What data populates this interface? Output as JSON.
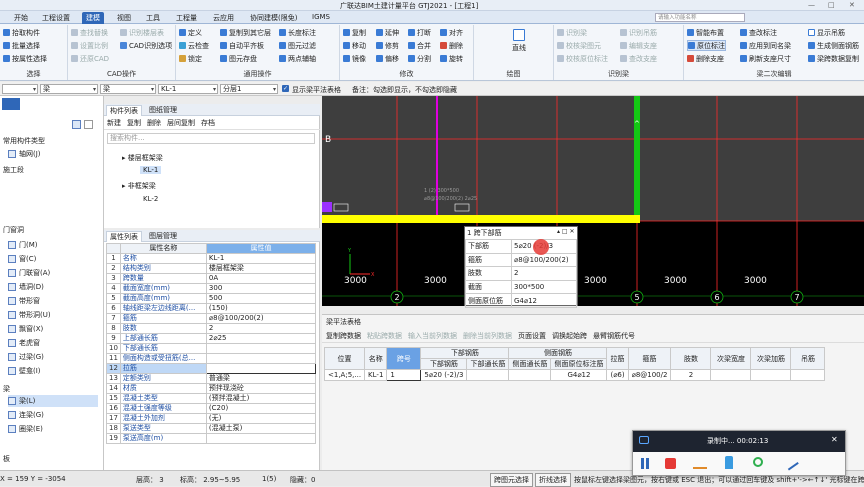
{
  "app": {
    "title": "广联达BIM土建计量平台 GTJ2021 - [工程1]",
    "window_controls": [
      "—",
      "□",
      "✕"
    ]
  },
  "ribbon_tabs": [
    "开始",
    "工程设置",
    "建模",
    "视图",
    "工具",
    "工程量",
    "云应用",
    "协同建模(限免)",
    "IGMS"
  ],
  "ribbon_active_tab": "建模",
  "search_placeholder": "请输入功能名称",
  "ribbon": {
    "select_group": {
      "label": "选择",
      "items": [
        "拾取构件",
        "批量选择",
        "按属性选择"
      ]
    },
    "cad_group": {
      "label": "CAD操作",
      "items": [
        "查找替换",
        "设置比例",
        "还原CAD",
        "识别楼层表",
        "CAD识别选项"
      ]
    },
    "common_group": {
      "label": "通用操作",
      "items": [
        "定义",
        "云检查",
        "锁定",
        "复制到其它层",
        "自动平齐板",
        "图元存盘",
        "长度标注",
        "图元过滤",
        "两点辅轴"
      ]
    },
    "modify_group": {
      "label": "修改",
      "items": [
        "复制",
        "移动",
        "镜像",
        "延伸",
        "修剪",
        "偏移",
        "打断",
        "合并",
        "分割",
        "对齐",
        "删除",
        "旋转"
      ]
    },
    "draw_group": {
      "label": "绘图",
      "items": [
        "直线"
      ]
    },
    "identify_group": {
      "label": "识别梁",
      "items": [
        "识别梁",
        "校核梁图元",
        "校核原位标注",
        "识别吊筋",
        "编辑支座",
        "查改支座"
      ]
    },
    "beam_group": {
      "label": "梁二次编辑",
      "items": [
        "智能布置",
        "原位标注",
        "删除支座",
        "查改标注",
        "应用到同名梁",
        "刷新支座尺寸",
        "显示吊筋",
        "生成侧面钢筋",
        "梁跨数据复制"
      ]
    }
  },
  "property_bar": {
    "floor_select": "",
    "category_select": "梁",
    "type_select": "梁",
    "name_select": "KL-1",
    "layer_select": "分层1",
    "show_beam_table_label": "显示梁平法表格",
    "hint": "备注：勾选即显示，不勾选即隐藏"
  },
  "left_nav": {
    "header": "常用构件类型",
    "items": [
      {
        "label": "轴网(J)",
        "icon": "grid-icon"
      },
      {
        "label": "施工段",
        "icon": "section-icon"
      },
      {
        "label": "门窗洞",
        "icon": "folder-icon"
      },
      {
        "label": "门(M)",
        "icon": "door-icon"
      },
      {
        "label": "窗(C)",
        "icon": "window-icon"
      },
      {
        "label": "门联窗(A)",
        "icon": "door-window-icon"
      },
      {
        "label": "墙洞(D)",
        "icon": "wall-hole-icon"
      },
      {
        "label": "带形窗",
        "icon": "strip-window-icon"
      },
      {
        "label": "带形洞(U)",
        "icon": "strip-hole-icon"
      },
      {
        "label": "飘窗(X)",
        "icon": "bay-window-icon"
      },
      {
        "label": "老虎窗",
        "icon": "dormer-icon"
      },
      {
        "label": "过梁(G)",
        "icon": "lintel-icon"
      },
      {
        "label": "壁龛(I)",
        "icon": "niche-icon"
      },
      {
        "label": "梁",
        "icon": "folder-icon"
      },
      {
        "label": "梁(L)",
        "icon": "beam-icon"
      },
      {
        "label": "连梁(G)",
        "icon": "coupling-beam-icon"
      },
      {
        "label": "圈梁(E)",
        "icon": "ring-beam-icon"
      },
      {
        "label": "板",
        "icon": "folder-icon"
      }
    ]
  },
  "component_panel": {
    "tabs": [
      "构件列表",
      "图纸管理"
    ],
    "toolbar": [
      "新建",
      "复制",
      "删除",
      "层间复制",
      "存档"
    ],
    "search_placeholder": "搜索构件...",
    "tree": [
      {
        "label": "楼层框架梁",
        "children": [
          "KL-1"
        ]
      },
      {
        "label": "非框架梁",
        "children": [
          "KL-2"
        ]
      }
    ]
  },
  "properties_panel": {
    "tabs": [
      "属性列表",
      "图层管理"
    ],
    "headers": [
      "属性名称",
      "属性值"
    ],
    "rows": [
      {
        "no": "1",
        "name": "名称",
        "value": "KL-1"
      },
      {
        "no": "2",
        "name": "结构类别",
        "value": "楼层框架梁"
      },
      {
        "no": "3",
        "name": "跨数量",
        "value": "0A"
      },
      {
        "no": "4",
        "name": "截面宽度(mm)",
        "value": "300"
      },
      {
        "no": "5",
        "name": "截面高度(mm)",
        "value": "500"
      },
      {
        "no": "6",
        "name": "轴线距梁左边线距离(...",
        "value": "(150)"
      },
      {
        "no": "7",
        "name": "箍筋",
        "value": "⌀8@100/200(2)"
      },
      {
        "no": "8",
        "name": "肢数",
        "value": "2"
      },
      {
        "no": "9",
        "name": "上部通长筋",
        "value": "2⌀25"
      },
      {
        "no": "10",
        "name": "下部通长筋",
        "value": ""
      },
      {
        "no": "11",
        "name": "侧面构造或受扭筋(总...",
        "value": ""
      },
      {
        "no": "12",
        "name": "拉筋",
        "value": ""
      },
      {
        "no": "13",
        "name": "定额类别",
        "value": "普通梁"
      },
      {
        "no": "14",
        "name": "材质",
        "value": "预拌现浇砼"
      },
      {
        "no": "15",
        "name": "混凝土类型",
        "value": "(预拌混凝土)"
      },
      {
        "no": "16",
        "name": "混凝土强度等级",
        "value": "(C20)"
      },
      {
        "no": "17",
        "name": "混凝土外加剂",
        "value": "(无)"
      },
      {
        "no": "18",
        "name": "泵送类型",
        "value": "(混凝土泵)"
      },
      {
        "no": "19",
        "name": "泵送高度(m)",
        "value": ""
      }
    ]
  },
  "canvas": {
    "axis_label": "B",
    "grid_labels": [
      "2",
      "3",
      "4",
      "5",
      "6",
      "7"
    ],
    "dims": [
      "3000",
      "3000",
      "3000",
      "3000",
      "3000",
      "3000"
    ],
    "note": "1 (2) 300*500",
    "note2": "⌀8@100/200(2) 2⌀25",
    "axes": {
      "x": "X",
      "y": "Y"
    }
  },
  "popup": {
    "title": "1 跨下部筋",
    "rows": [
      {
        "k": "下部筋",
        "v": "5⌀20 (-2)/3"
      },
      {
        "k": "箍筋",
        "v": "⌀8@100/200(2)"
      },
      {
        "k": "肢数",
        "v": "2"
      },
      {
        "k": "截面",
        "v": "300*500"
      },
      {
        "k": "侧面原位筋",
        "v": "G4⌀12"
      }
    ]
  },
  "beam_table": {
    "title": "梁平法表格",
    "toolbar": [
      {
        "label": "复制跨数据",
        "enabled": true
      },
      {
        "label": "粘贴跨数据",
        "enabled": false
      },
      {
        "label": "输入当前列数据",
        "enabled": false
      },
      {
        "label": "删除当前列数据",
        "enabled": false
      },
      {
        "label": "页面设置",
        "enabled": true
      },
      {
        "label": "调换起始跨",
        "enabled": true
      },
      {
        "label": "悬臂钢筋代号",
        "enabled": true
      }
    ],
    "group_headers": [
      "下部钢筋",
      "侧面钢筋"
    ],
    "headers": [
      "位置",
      "名称",
      "跨号",
      "下部钢筋",
      "下部通长筋",
      "侧面通长筋",
      "侧面原位标注筋",
      "拉筋",
      "箍筋",
      "肢数",
      "次梁宽度",
      "次梁加筋",
      "吊筋"
    ],
    "rows": [
      [
        "<1,A;5,...",
        "KL-1",
        "1",
        "5⌀20 (-2)/3",
        "",
        "",
        "G4⌀12",
        "(⌀6)",
        "⌀8@100/2",
        "2",
        "",
        "",
        ""
      ]
    ]
  },
  "status_bar": {
    "coords": "X = 159 Y = -3054",
    "floor_height": "层高：  3",
    "elevation": "标高：  2.95~5.95",
    "count": "1(5)",
    "hidden": "隐藏：0",
    "btn_span_select": "跨图元选择",
    "btn_polyline": "折线选择",
    "hint": "按鼠标左键选择梁图元，按右键或 ESC 退出；可以通过回车键及 shift+'->←↑↓' 光标键在跨之间、上下输入框之间进行切换"
  },
  "recorder": {
    "status": "录制中... 00:02:13",
    "close": "✕"
  },
  "colors": {
    "accent": "#2f67b8",
    "canvas_bg": "#000000",
    "grid_line": "#ff2b2b",
    "beam_yellow": "#ffff00",
    "wall_green": "#14c814",
    "magenta": "#e000e0",
    "record_red": "#e53935"
  }
}
